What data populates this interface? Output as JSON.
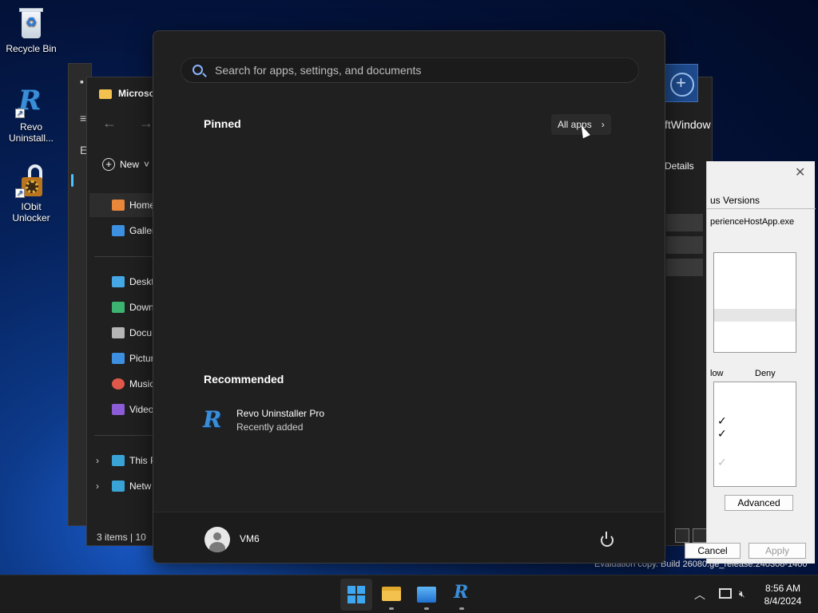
{
  "desktop": {
    "icons": [
      {
        "label": "Recycle Bin",
        "icon": "recycle-bin-icon"
      },
      {
        "label": "Revo Uninstall...",
        "icon": "revo-uninstaller-icon"
      },
      {
        "label": "IObit Unlocker",
        "icon": "iobit-unlocker-icon"
      }
    ]
  },
  "explorer": {
    "title": "Microso",
    "new_label": "New",
    "sidebar": [
      {
        "label": "Home",
        "icon": "home-icon",
        "color": "#e8863a"
      },
      {
        "label": "Galler",
        "icon": "gallery-icon",
        "color": "#3d8fe0"
      },
      {
        "label": "Deskt",
        "icon": "desktop-folder-icon",
        "color": "#46a7e6"
      },
      {
        "label": "Down",
        "icon": "downloads-icon",
        "color": "#3cb371"
      },
      {
        "label": "Docu",
        "icon": "documents-icon",
        "color": "#b5b5b5"
      },
      {
        "label": "Pictur",
        "icon": "pictures-icon",
        "color": "#3d8fe0"
      },
      {
        "label": "Music",
        "icon": "music-icon",
        "color": "#e0584a"
      },
      {
        "label": "Video",
        "icon": "videos-icon",
        "color": "#8c5bd6"
      },
      {
        "label": "This P",
        "icon": "this-pc-icon",
        "color": "#39a3d6"
      },
      {
        "label": "Netw",
        "icon": "network-icon",
        "color": "#39a3d6"
      }
    ],
    "status": "3 items  |  10",
    "right_title": "ftWindow",
    "right_details": "Details"
  },
  "properties": {
    "tab": "us Versions",
    "path": "perienceHostApp.exe",
    "allow": "low",
    "deny": "Deny",
    "advanced": "Advanced",
    "cancel": "Cancel",
    "apply": "Apply"
  },
  "start_menu": {
    "search_placeholder": "Search for apps, settings, and documents",
    "pinned": "Pinned",
    "all_apps": "All apps",
    "recommended": "Recommended",
    "recommended_items": [
      {
        "name": "Revo Uninstaller Pro",
        "sub": "Recently added",
        "icon": "revo-uninstaller-icon"
      }
    ],
    "user": "VM6"
  },
  "watermark": "Evaluation copy. Build 26080.ge_release.240308-1400",
  "taskbar": {
    "apps": [
      {
        "name": "start",
        "icon": "windows-logo-icon"
      },
      {
        "name": "file-explorer",
        "icon": "folder-icon"
      },
      {
        "name": "photos",
        "icon": "photos-icon"
      },
      {
        "name": "revo-uninstaller",
        "icon": "revo-uninstaller-icon"
      }
    ],
    "time": "8:56 AM",
    "date": "8/4/2024"
  },
  "colors": {
    "accent": "#3ea7f2",
    "start_bg": "#202020"
  }
}
